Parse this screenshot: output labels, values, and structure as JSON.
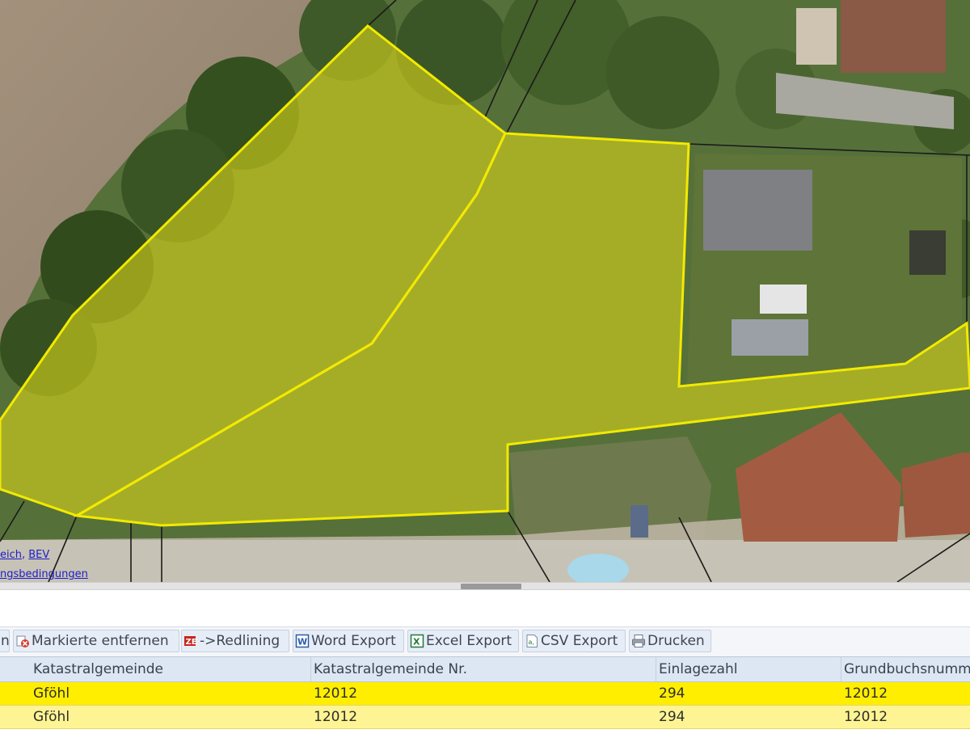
{
  "map": {
    "attribution": {
      "line1_part1": "eich",
      "separator": ", ",
      "line1_part2": "BEV",
      "line2": "ngsbedingungen"
    },
    "parcel_highlight_color": "#e8e100",
    "parcel_fill_color": "#d6d41c"
  },
  "toolbar": {
    "buttons": [
      {
        "label": "n",
        "icon": "truncated-icon"
      },
      {
        "label": "Markierte entfernen",
        "icon": "remove-marked-icon"
      },
      {
        "label": "->Redlining",
        "icon": "redlining-icon"
      },
      {
        "label": "Word Export",
        "icon": "word-icon"
      },
      {
        "label": "Excel Export",
        "icon": "excel-icon"
      },
      {
        "label": "CSV Export",
        "icon": "csv-icon"
      },
      {
        "label": "Drucken",
        "icon": "printer-icon"
      }
    ]
  },
  "table": {
    "columns": [
      "Katastralgemeinde",
      "Katastralgemeinde Nr.",
      "Einlagezahl",
      "Grundbuchsnumm"
    ],
    "rows": [
      {
        "katastralgemeinde": "Gföhl",
        "kg_nr": "12012",
        "einlagezahl": "294",
        "grundbuchsnummer": "12012"
      },
      {
        "katastralgemeinde": "Gföhl",
        "kg_nr": "12012",
        "einlagezahl": "294",
        "grundbuchsnummer": "12012"
      }
    ],
    "selected_row_color": "#ffee00",
    "highlight_row_color": "#fff493"
  }
}
